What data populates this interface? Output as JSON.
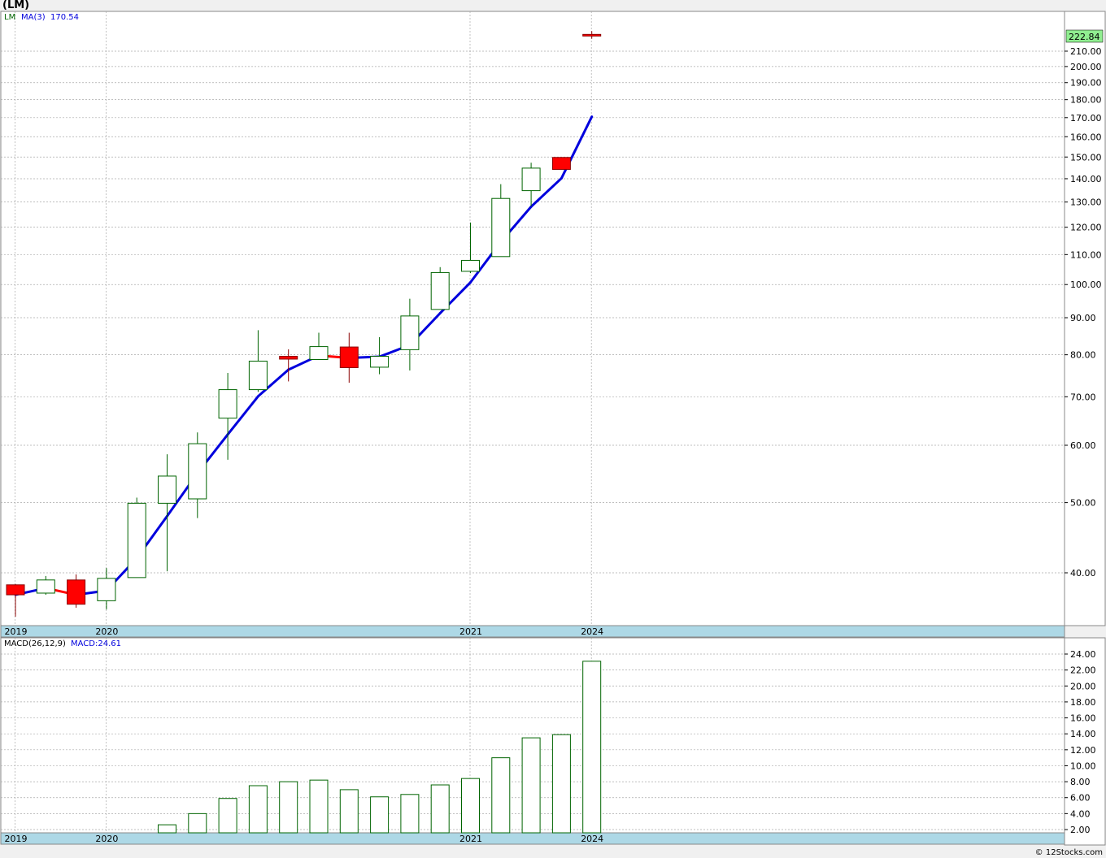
{
  "title": "(LM)",
  "footer": "© 12Stocks.com",
  "colors": {
    "up_body": "#ffffff",
    "up_stroke": "#006400",
    "down_body": "#ff0000",
    "down_stroke": "#8b0000",
    "ma_up": "#0000dd",
    "ma_down": "#ff0000",
    "macd_bar": "#006400",
    "grid": "#aaaaaa",
    "axis_band": "#add8e6",
    "last_price_label": "#90ee90"
  },
  "chart_data": [
    {
      "type": "candlestick",
      "scale": "log",
      "legend": {
        "symbol": "LM",
        "ma_label": "MA(3)",
        "ma_value": "170.54"
      },
      "last_price_label": "222.84",
      "y_ticks": [
        "40.00",
        "50.00",
        "60.00",
        "70.00",
        "80.00",
        "90.00",
        "100.00",
        "110.00",
        "120.00",
        "130.00",
        "140.00",
        "150.00",
        "160.00",
        "170.00",
        "180.00",
        "190.00",
        "200.00",
        "210.00"
      ],
      "x_labels": [
        {
          "label": "2019",
          "index": 0
        },
        {
          "label": "2020",
          "index": 3
        },
        {
          "label": "2021",
          "index": 15
        },
        {
          "label": "2024",
          "index": 19
        }
      ],
      "candles": [
        {
          "o": 38.5,
          "h": 38.6,
          "l": 34.8,
          "c": 37.3
        },
        {
          "o": 37.5,
          "h": 39.6,
          "l": 37.3,
          "c": 39.1
        },
        {
          "o": 39.1,
          "h": 39.8,
          "l": 35.8,
          "c": 36.2
        },
        {
          "o": 36.6,
          "h": 40.6,
          "l": 35.6,
          "c": 39.3
        },
        {
          "o": 39.4,
          "h": 50.8,
          "l": 39.4,
          "c": 49.9
        },
        {
          "o": 49.9,
          "h": 58.3,
          "l": 40.2,
          "c": 54.4
        },
        {
          "o": 50.6,
          "h": 62.5,
          "l": 47.6,
          "c": 60.3
        },
        {
          "o": 65.4,
          "h": 75.5,
          "l": 57.3,
          "c": 71.6
        },
        {
          "o": 71.6,
          "h": 86.5,
          "l": 71.1,
          "c": 78.4
        },
        {
          "o": 79.6,
          "h": 81.4,
          "l": 73.5,
          "c": 78.9
        },
        {
          "o": 78.8,
          "h": 85.8,
          "l": 78.7,
          "c": 82.1
        },
        {
          "o": 82.0,
          "h": 85.8,
          "l": 73.2,
          "c": 76.8
        },
        {
          "o": 76.9,
          "h": 84.6,
          "l": 75.2,
          "c": 79.6
        },
        {
          "o": 81.3,
          "h": 95.6,
          "l": 76.1,
          "c": 90.5
        },
        {
          "o": 92.4,
          "h": 105.7,
          "l": 92.4,
          "c": 103.9
        },
        {
          "o": 104.3,
          "h": 121.8,
          "l": 103.7,
          "c": 108.0
        },
        {
          "o": 109.3,
          "h": 137.6,
          "l": 109.3,
          "c": 131.5
        },
        {
          "o": 134.8,
          "h": 147.3,
          "l": 128.3,
          "c": 144.8
        },
        {
          "o": 149.8,
          "h": 149.8,
          "l": 144.0,
          "c": 144.2
        },
        {
          "o": 221.5,
          "h": 223.8,
          "l": 218.5,
          "c": 220.8
        }
      ],
      "ma": [
        37.3,
        38.1,
        37.3,
        37.8,
        41.9,
        47.9,
        54.9,
        62.1,
        70.1,
        76.3,
        79.8,
        79.2,
        79.5,
        82.5,
        91.3,
        100.7,
        114.5,
        128.1,
        140.2,
        170.5
      ]
    },
    {
      "type": "bar",
      "legend": {
        "label": "MACD(26,12,9)",
        "value_label": "MACD:24.61"
      },
      "y_ticks": [
        "2.00",
        "4.00",
        "6.00",
        "8.00",
        "10.00",
        "12.00",
        "14.00",
        "16.00",
        "18.00",
        "20.00",
        "22.00",
        "24.00"
      ],
      "x_labels": [
        {
          "label": "2019",
          "index": 0
        },
        {
          "label": "2020",
          "index": 3
        },
        {
          "label": "2021",
          "index": 15
        },
        {
          "label": "2024",
          "index": 19
        }
      ],
      "values": [
        0.2,
        0.4,
        0.0,
        0.2,
        1.4,
        2.6,
        4.0,
        5.9,
        7.5,
        8.0,
        8.2,
        7.0,
        6.1,
        6.4,
        7.6,
        8.4,
        11.0,
        13.5,
        13.9,
        23.1
      ]
    }
  ]
}
